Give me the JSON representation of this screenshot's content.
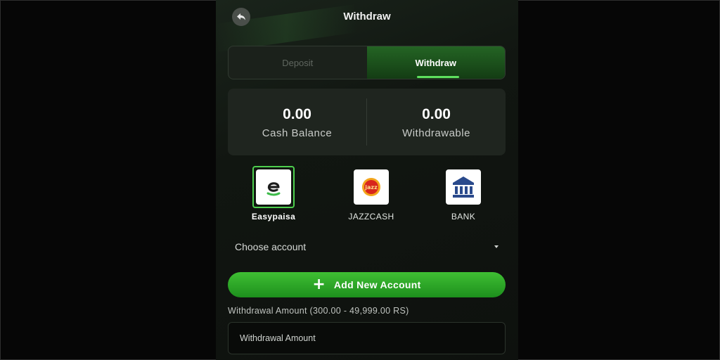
{
  "header": {
    "title": "Withdraw",
    "back_icon": "back-arrow-icon"
  },
  "tabs": [
    {
      "label": "Deposit",
      "active": false
    },
    {
      "label": "Withdraw",
      "active": true
    }
  ],
  "balances": {
    "cash": {
      "value": "0.00",
      "label": "Cash Balance"
    },
    "withdrawable": {
      "value": "0.00",
      "label": "Withdrawable"
    }
  },
  "methods": [
    {
      "label": "Easypaisa",
      "icon": "easypaisa-icon",
      "selected": true
    },
    {
      "label": "JAZZCASH",
      "icon": "jazzcash-icon",
      "selected": false
    },
    {
      "label": "BANK",
      "icon": "bank-icon",
      "selected": false
    }
  ],
  "account_select": {
    "placeholder": "Choose account"
  },
  "add_account": {
    "label": "Add New Account"
  },
  "amount": {
    "label": "Withdrawal Amount (300.00 - 49,999.00 RS)",
    "placeholder": "Withdrawal Amount"
  },
  "colors": {
    "accent": "#3fbf33",
    "selected_border": "#4ecf4e",
    "background": "#111611"
  }
}
